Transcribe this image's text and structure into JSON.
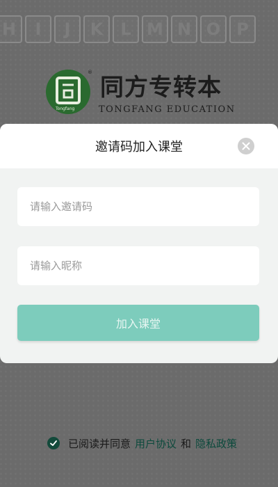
{
  "background": {
    "letters": [
      "H",
      "I",
      "J",
      "K",
      "L",
      "M",
      "N",
      "O",
      "P"
    ],
    "logo_title": "同方专转本",
    "logo_subtitle": "TONGFANG EDUCATION",
    "logo_seal_text": "Tongfang"
  },
  "modal": {
    "title": "邀请码加入课堂",
    "invite_input": {
      "value": "",
      "placeholder": "请输入邀请码"
    },
    "nickname_input": {
      "value": "",
      "placeholder": "请输入昵称"
    },
    "join_label": "加入课堂"
  },
  "agreement": {
    "prefix": "已阅读并同意",
    "user_agreement": "用户协议",
    "and": "和",
    "privacy_policy": "隐私政策"
  },
  "colors": {
    "accent": "#7dccbc",
    "link": "#0c4a3c",
    "check": "#134a3b",
    "logo_green": "#2a6a2f"
  }
}
